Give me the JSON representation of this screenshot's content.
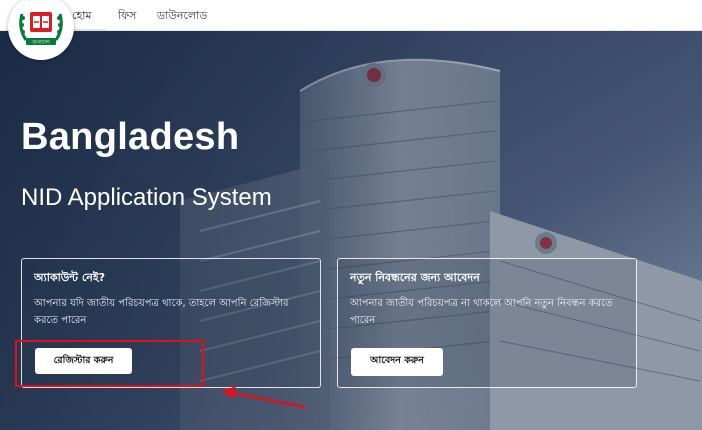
{
  "nav": {
    "items": [
      {
        "label": "হোম",
        "active": true
      },
      {
        "label": "ফিস",
        "active": false
      },
      {
        "label": "ডাউনলোড",
        "active": false
      }
    ]
  },
  "logo": {
    "emblem_letter": "বাংলাদেশ"
  },
  "hero": {
    "title": "Bangladesh",
    "subtitle": "NID Application System"
  },
  "cards": [
    {
      "title": "অ্যাকাউন্ট নেই?",
      "text": "আপনার যদি জাতীয় পরিচয়পত্র থাকে, তাহলে আপনি রেজিস্টার করতে পারেন",
      "button": "রেজিস্টার করুন"
    },
    {
      "title": "নতুন নিবন্ধনের জন্য আবেদন",
      "text": "আপনার জাতীয় পরিচয়পত্র না থাকলে আপনি নতুন নিবন্ধন করতে পারেন",
      "button": "আবেদন করুন"
    }
  ],
  "colors": {
    "annotation_red": "#e0101a",
    "emblem_green": "#0a7a3a",
    "emblem_red": "#d81f26"
  }
}
